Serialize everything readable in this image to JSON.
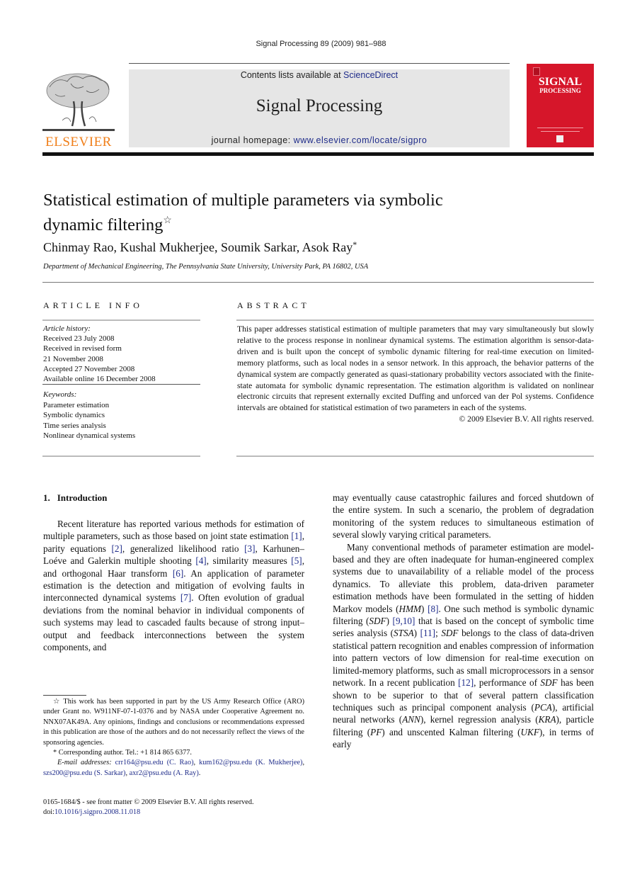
{
  "running_head": "Signal Processing 89 (2009) 981–988",
  "banner": {
    "contents_prefix": "Contents lists available at ",
    "contents_link": "ScienceDirect",
    "journal_name": "Signal Processing",
    "homepage_prefix": "journal homepage: ",
    "homepage_link": "www.elsevier.com/locate/sigpro"
  },
  "publisher_logo": {
    "icon": "elsevier-tree-logo",
    "wordmark": "ELSEVIER"
  },
  "cover": {
    "icon": "journal-cover",
    "title": "SIGNAL",
    "subtitle": "PROCESSING"
  },
  "article": {
    "title": "Statistical estimation of multiple parameters via symbolic dynamic filtering",
    "title_note_mark": "☆",
    "authors": "Chinmay Rao, Kushal Mukherjee, Soumik Sarkar, Asok Ray",
    "corresponding_mark": "*",
    "affiliation": "Department of Mechanical Engineering, The Pennsylvania State University, University Park, PA 16802, USA"
  },
  "article_info": {
    "heading": "ARTICLE INFO",
    "history_label": "Article history:",
    "history": [
      "Received 23 July 2008",
      "Received in revised form",
      "21 November 2008",
      "Accepted 27 November 2008",
      "Available online 16 December 2008"
    ],
    "keywords_label": "Keywords:",
    "keywords": [
      "Parameter estimation",
      "Symbolic dynamics",
      "Time series analysis",
      "Nonlinear dynamical systems"
    ]
  },
  "abstract": {
    "heading": "ABSTRACT",
    "text": "This paper addresses statistical estimation of multiple parameters that may vary simultaneously but slowly relative to the process response in nonlinear dynamical systems. The estimation algorithm is sensor-data-driven and is built upon the concept of symbolic dynamic filtering for real-time execution on limited-memory platforms, such as local nodes in a sensor network. In this approach, the behavior patterns of the dynamical system are compactly generated as quasi-stationary probability vectors associated with the finite-state automata for symbolic dynamic representation. The estimation algorithm is validated on nonlinear electronic circuits that represent externally excited Duffing and unforced van der Pol systems. Confidence intervals are obtained for statistical estimation of two parameters in each of the systems.",
    "copyright": "© 2009 Elsevier B.V. All rights reserved."
  },
  "section": {
    "number": "1.",
    "title": "Introduction"
  },
  "body": {
    "left": {
      "p1": [
        {
          "t": "Recent literature has reported various methods for estimation of multiple parameters, such as those based on joint state estimation "
        },
        {
          "c": "[1]"
        },
        {
          "t": ", parity equations "
        },
        {
          "c": "[2]"
        },
        {
          "t": ", generalized likelihood ratio "
        },
        {
          "c": "[3]"
        },
        {
          "t": ", Karhunen–Loéve and Galerkin multiple shooting "
        },
        {
          "c": "[4]"
        },
        {
          "t": ", similarity measures "
        },
        {
          "c": "[5]"
        },
        {
          "t": ", and orthogonal Haar transform "
        },
        {
          "c": "[6]"
        },
        {
          "t": ". An application of parameter estimation is the detection and mitigation of evolving faults in interconnected dynamical systems "
        },
        {
          "c": "[7]"
        },
        {
          "t": ". Often evolution of gradual deviations from the nominal behavior in individual components of such systems may lead to cascaded faults because of strong input–output and feedback interconnections between the system components, and"
        }
      ]
    },
    "right": {
      "p1_cont": "may eventually cause catastrophic failures and forced shutdown of the entire system. In such a scenario, the problem of degradation monitoring of the system reduces to simultaneous estimation of several slowly varying critical parameters.",
      "p2": [
        {
          "t": "Many conventional methods of parameter estimation are model-based and they are often inadequate for human-engineered complex systems due to unavailability of a reliable model of the process dynamics. To alleviate this problem, data-driven parameter estimation methods have been formulated in the setting of hidden Markov models ("
        },
        {
          "i": "HMM"
        },
        {
          "t": ") "
        },
        {
          "c": "[8]"
        },
        {
          "t": ". One such method is symbolic dynamic filtering ("
        },
        {
          "i": "SDF"
        },
        {
          "t": ") "
        },
        {
          "c": "[9,10]"
        },
        {
          "t": " that is based on the concept of symbolic time series analysis ("
        },
        {
          "i": "STSA"
        },
        {
          "t": ") "
        },
        {
          "c": "[11]"
        },
        {
          "t": "; "
        },
        {
          "i": "SDF"
        },
        {
          "t": " belongs to the class of data-driven statistical pattern recognition and enables compression of information into pattern vectors of low dimension for real-time execution on limited-memory platforms, such as small microprocessors in a sensor network. In a recent publication "
        },
        {
          "c": "[12]"
        },
        {
          "t": ", performance of "
        },
        {
          "i": "SDF"
        },
        {
          "t": " has been shown to be superior to that of several pattern classification techniques such as principal component analysis ("
        },
        {
          "i": "PCA"
        },
        {
          "t": "), artificial neural networks ("
        },
        {
          "i": "ANN"
        },
        {
          "t": "), kernel regression analysis ("
        },
        {
          "i": "KRA"
        },
        {
          "t": "), particle filtering ("
        },
        {
          "i": "PF"
        },
        {
          "t": ") and unscented Kalman filtering ("
        },
        {
          "i": "UKF"
        },
        {
          "t": "), in terms of early"
        }
      ]
    }
  },
  "footnotes": {
    "star_mark": "☆",
    "funding": "This work has been supported in part by the US Army Research Office (ARO) under Grant no. W911NF-07-1-0376 and by NASA under Cooperative Agreement no. NNX07AK49A. Any opinions, findings and conclusions or recommendations expressed in this publication are those of the authors and do not necessarily reflect the views of the sponsoring agencies.",
    "corr_mark": "*",
    "corresponding": "Corresponding author. Tel.: +1 814 865 6377.",
    "email_label": "E-mail addresses:",
    "emails": [
      {
        "addr": "crr164@psu.edu",
        "name": "(C. Rao)"
      },
      {
        "addr": "kum162@psu.edu",
        "name": "(K. Mukherjee)"
      },
      {
        "addr": "szs200@psu.edu",
        "name": "(S. Sarkar)"
      },
      {
        "addr": "axr2@psu.edu",
        "name": "(A. Ray)"
      }
    ],
    "front_matter": "0165-1684/$ - see front matter © 2009 Elsevier B.V. All rights reserved.",
    "doi_prefix": "doi:",
    "doi": "10.1016/j.sigpro.2008.11.018"
  },
  "colors": {
    "link": "#1f2c8a",
    "banner_bg": "#e6e6e6",
    "cover_red": "#d6162a",
    "elsevier_orange": "#f07f1a"
  }
}
